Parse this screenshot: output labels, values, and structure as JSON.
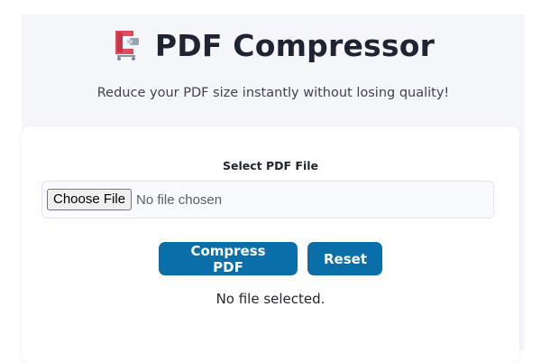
{
  "header": {
    "icon": "compress-clamp-icon",
    "title": "PDF Compressor",
    "subtitle": "Reduce your PDF size instantly without losing quality!"
  },
  "form": {
    "label": "Select PDF File",
    "file_button": "Choose File",
    "file_status": "No file chosen"
  },
  "actions": {
    "compress_label": "Compress PDF",
    "reset_label": "Reset"
  },
  "status": "No file selected.",
  "colors": {
    "accent": "#0a6fa8",
    "icon_red": "#e04a5a",
    "background": "#f5f6fa"
  }
}
